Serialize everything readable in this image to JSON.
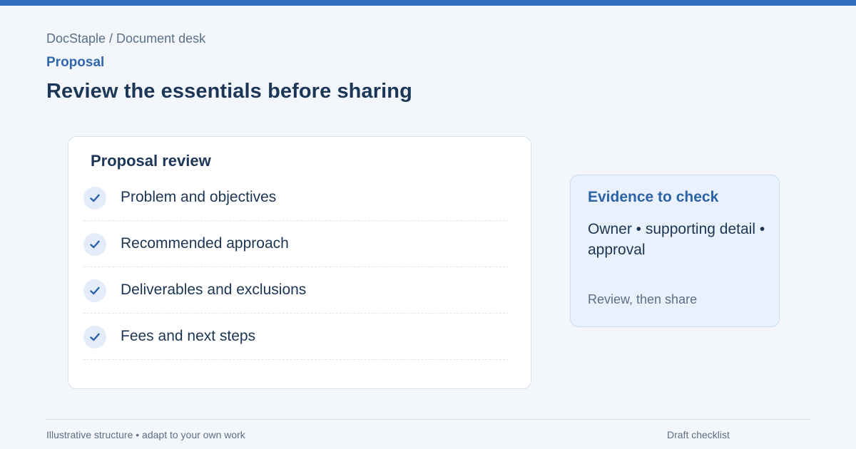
{
  "header": {
    "breadcrumb": "DocStaple / Document desk",
    "eyebrow": "Proposal",
    "title": "Review the essentials before sharing"
  },
  "review_card": {
    "title": "Proposal review",
    "items": [
      {
        "label": "Problem and objectives",
        "checked": true,
        "icon": "checkmark-icon"
      },
      {
        "label": "Recommended approach",
        "checked": true,
        "icon": "checkmark-icon"
      },
      {
        "label": "Deliverables and exclusions",
        "checked": true,
        "icon": "checkmark-icon"
      },
      {
        "label": "Fees and next steps",
        "checked": true,
        "icon": "checkmark-icon"
      }
    ]
  },
  "evidence_card": {
    "title": "Evidence to check",
    "body": "Owner • supporting detail • approval",
    "note": "Review, then share"
  },
  "footer": {
    "left": "Illustrative structure • adapt to your own work",
    "right": "Draft checklist"
  },
  "colors": {
    "accent": "#2f6dbf",
    "background": "#f3f7fc",
    "heading": "#1b3657",
    "evidence_background": "#e9f1fc"
  }
}
